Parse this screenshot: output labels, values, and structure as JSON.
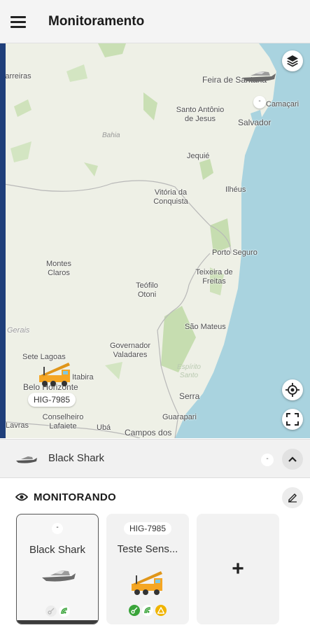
{
  "appbar": {
    "title": "Monitoramento",
    "menu_icon": "hamburger-menu-icon"
  },
  "map": {
    "cities": [
      {
        "name": "Barreiras"
      },
      {
        "name": "Feira de Santana"
      },
      {
        "name": "Camaçari"
      },
      {
        "name": "Santo Antônio de Jesus"
      },
      {
        "name": "Salvador"
      },
      {
        "name": "Jequié"
      },
      {
        "name": "Vitória da Conquista"
      },
      {
        "name": "Ilhéus"
      },
      {
        "name": "Porto Seguro"
      },
      {
        "name": "Montes Claros"
      },
      {
        "name": "Teixeira de Freitas"
      },
      {
        "name": "Teófilo Otoni"
      },
      {
        "name": "Gerais"
      },
      {
        "name": "São Mateus"
      },
      {
        "name": "Sete Lagoas"
      },
      {
        "name": "Governador Valadares"
      },
      {
        "name": "Itabira"
      },
      {
        "name": "Belo Horizonte"
      },
      {
        "name": "Espírito Santo"
      },
      {
        "name": "Serra"
      },
      {
        "name": "Conselheiro Lafaiete"
      },
      {
        "name": "Guarapari"
      },
      {
        "name": "Lavras"
      },
      {
        "name": "Ubá"
      },
      {
        "name": "Campos dos"
      }
    ],
    "region_labels": {
      "bahia": "Bahia"
    },
    "vehicle_tags": {
      "crane_plate": "HIG-7985",
      "boat_dash": "-"
    },
    "buttons": {
      "layers_icon": "layers-icon",
      "locate_icon": "crosshair-icon",
      "fullscreen_icon": "fullscreen-icon"
    }
  },
  "selected": {
    "name": "Black Shark",
    "status": "-",
    "collapse_icon": "chevron-up-icon"
  },
  "monitoring": {
    "title": "MONITORANDO",
    "eye_icon": "eye-icon",
    "edit_icon": "edit-icon",
    "cards": [
      {
        "chip": "-",
        "name": "Black Shark",
        "vehicle_icon": "boat-icon",
        "status_icons": [
          "key-off-icon",
          "signal-icon"
        ]
      },
      {
        "chip": "HIG-7985",
        "name": "Teste Sens...",
        "vehicle_icon": "crane-truck-icon",
        "status_icons": [
          "key-on-icon",
          "signal-icon",
          "warning-icon"
        ]
      }
    ],
    "add_label": "+"
  },
  "colors": {
    "ocean": "#a9d3df",
    "land": "#eef0e6",
    "green_status": "#3aa43a",
    "warning": "#f0b400",
    "crane": "#f5a623",
    "edge": "#1f3f7a"
  }
}
